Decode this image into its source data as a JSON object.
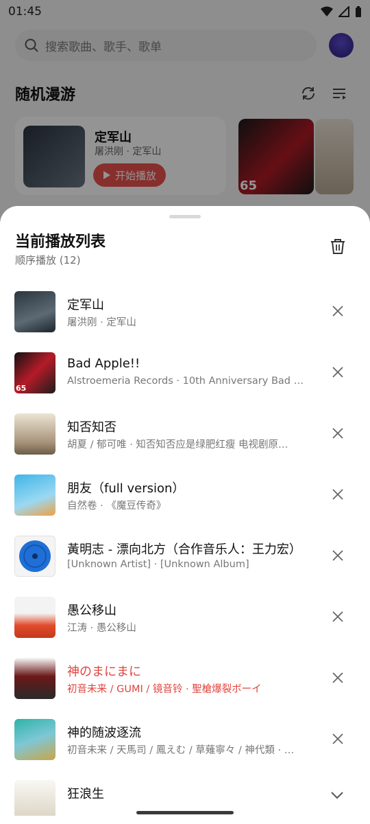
{
  "status": {
    "time": "01:45"
  },
  "background": {
    "search_placeholder": "搜索歌曲、歌手、歌单",
    "section_title": "随机漫游",
    "card": {
      "title": "定军山",
      "subtitle": "屠洪刚 · 定军山",
      "play_label": "开始播放"
    },
    "tile_badge": "65"
  },
  "sheet": {
    "title": "当前播放列表",
    "subtitle": "顺序播放 (12)",
    "songs": [
      {
        "title": "定军山",
        "meta": "屠洪刚 · 定军山"
      },
      {
        "title": "Bad Apple!!",
        "meta": "Alstroemeria Records · 10th Anniversary Bad …",
        "badge": "65"
      },
      {
        "title": "知否知否",
        "meta": "胡夏 / 郁可唯 · 知否知否应是绿肥红瘦 电视剧原…"
      },
      {
        "title": "朋友（full version）",
        "meta": "自然卷 · 《魔豆传奇》"
      },
      {
        "title": "黃明志 - 漂向北方（合作音乐人：王力宏）",
        "meta": "[Unknown Artist] · [Unknown Album]"
      },
      {
        "title": "愚公移山",
        "meta": "江涛 · 愚公移山"
      },
      {
        "title": "神のまにまに",
        "meta": "初音未来 / GUMI / 镜音铃 · 聖槍爆裂ボーイ",
        "active": true
      },
      {
        "title": "神的随波逐流",
        "meta": "初音未来 / 天馬司 / 鳳えむ / 草薙寧々 / 神代類 · …"
      },
      {
        "title": "狂浪生",
        "meta": ""
      }
    ]
  },
  "colors": {
    "accent": "#e0443f"
  }
}
